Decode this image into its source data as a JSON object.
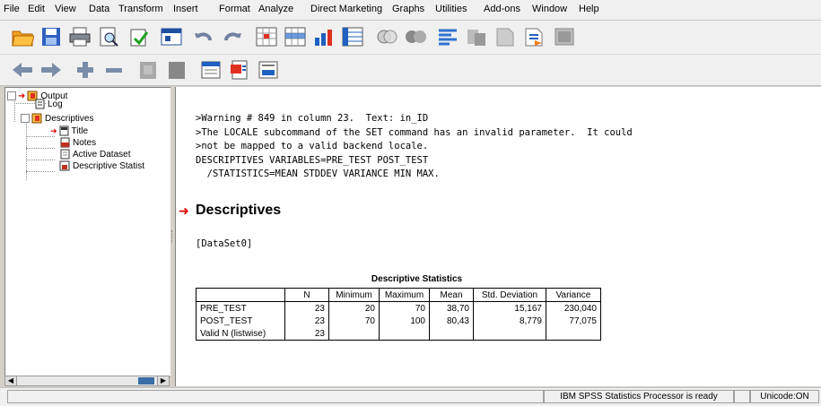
{
  "menu": [
    "File",
    "Edit",
    "View",
    "Data",
    "Transform",
    "Insert",
    "Format",
    "Analyze",
    "Direct Marketing",
    "Graphs",
    "Utilities",
    "Add-ons",
    "Window",
    "Help"
  ],
  "outline": {
    "root": "Output",
    "log": "Log",
    "descriptives": "Descriptives",
    "title": "Title",
    "notes": "Notes",
    "active_dataset": "Active Dataset",
    "descriptive_stats": "Descriptive Statist"
  },
  "syntax": {
    "line1": ">Warning # 849 in column 23.  Text: in_ID",
    "line2": ">The LOCALE subcommand of the SET command has an invalid parameter.  It could",
    "line3": ">not be mapped to a valid backend locale.",
    "line4": "DESCRIPTIVES VARIABLES=PRE_TEST POST_TEST",
    "line5": "  /STATISTICS=MEAN STDDEV VARIANCE MIN MAX."
  },
  "section_title": "Descriptives",
  "dataset": "[DataSet0]",
  "table": {
    "title": "Descriptive Statistics",
    "headers": [
      "",
      "N",
      "Minimum",
      "Maximum",
      "Mean",
      "Std. Deviation",
      "Variance"
    ],
    "rows": [
      [
        "PRE_TEST",
        "23",
        "20",
        "70",
        "38,70",
        "15,167",
        "230,040"
      ],
      [
        "POST_TEST",
        "23",
        "70",
        "100",
        "80,43",
        "8,779",
        "77,075"
      ],
      [
        "Valid N (listwise)",
        "23",
        "",
        "",
        "",
        "",
        ""
      ]
    ]
  },
  "status": {
    "processor": "IBM SPSS Statistics Processor is ready",
    "encoding": "Unicode:ON"
  }
}
